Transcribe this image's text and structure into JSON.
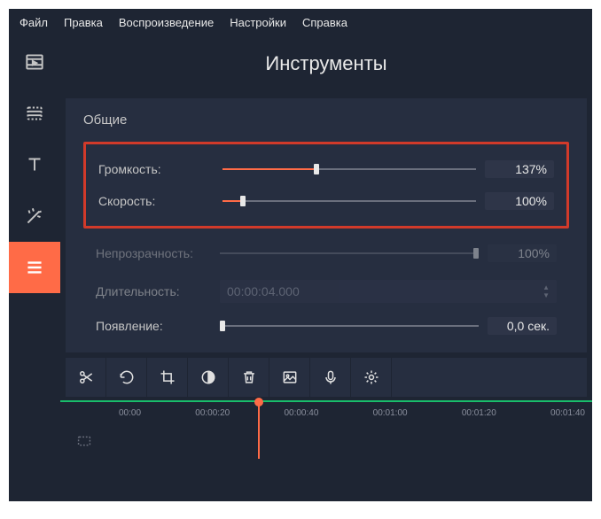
{
  "menu": {
    "file": "Файл",
    "edit": "Правка",
    "playback": "Воспроизведение",
    "settings": "Настройки",
    "help": "Справка"
  },
  "panel": {
    "title": "Инструменты",
    "section": "Общие",
    "volume": {
      "label": "Громкость:",
      "value": "137%",
      "fill": 36
    },
    "speed": {
      "label": "Скорость:",
      "value": "100%",
      "fill": 7
    },
    "opacity": {
      "label": "Непрозрачность:",
      "value": "100%",
      "fill": 100
    },
    "duration": {
      "label": "Длительность:",
      "value": "00:00:04.000"
    },
    "fadein": {
      "label": "Появление:",
      "value": "0,0 сек.",
      "fill": 0
    }
  },
  "timeline": {
    "ticks": [
      "00:00",
      "00:00:20",
      "00:00:40",
      "00:01:00",
      "00:01:20",
      "00:01:40"
    ]
  }
}
